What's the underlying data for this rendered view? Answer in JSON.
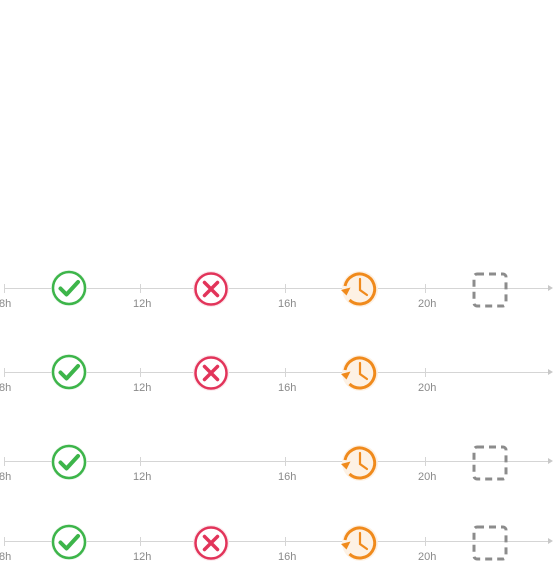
{
  "ticks": [
    "8h",
    "12h",
    "16h",
    "20h"
  ],
  "status_colors": {
    "success": "#3db54a",
    "failed": "#e2345a",
    "scheduled": "#f08a1c",
    "pending": "#8c8c8c"
  },
  "timelines": [
    {
      "markers": [
        "success-icon",
        "failed-icon",
        "scheduled-icon",
        "pending-icon"
      ]
    },
    {
      "markers": [
        "success-icon",
        "failed-icon",
        "scheduled-icon"
      ]
    },
    {
      "markers": [
        "success-icon",
        "scheduled-icon",
        "pending-icon"
      ]
    },
    {
      "markers": [
        "success-icon",
        "failed-icon",
        "scheduled-icon",
        "pending-icon"
      ]
    }
  ]
}
